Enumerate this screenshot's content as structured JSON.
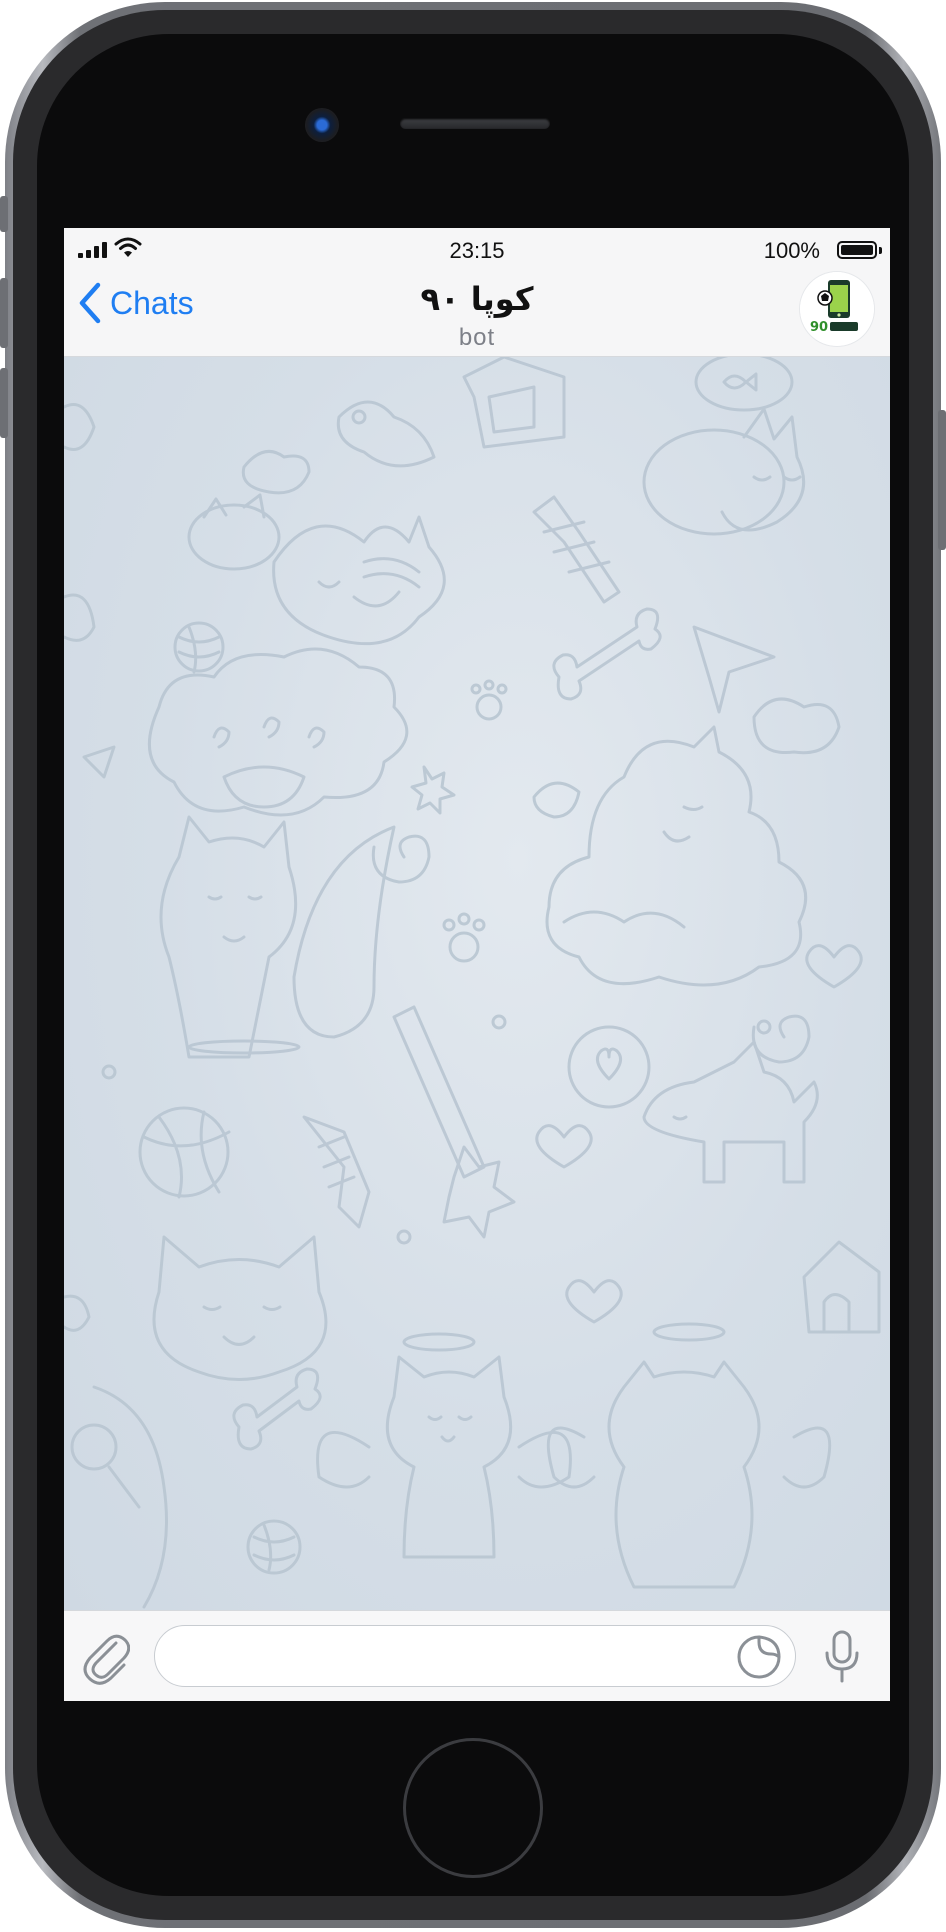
{
  "status_bar": {
    "time": "23:15",
    "battery_percent": "100%",
    "battery_level": 1.0,
    "icons": [
      "signal-icon",
      "wifi-icon",
      "battery-icon"
    ]
  },
  "nav_bar": {
    "back_label": "Chats",
    "title": "کوپا ۹۰",
    "subtitle": "bot",
    "back_icon": "chevron-left-icon",
    "avatar_icon": "bot-avatar-icon",
    "accent_color": "#1f7ef2"
  },
  "chat": {
    "background_color": "#d3dde6",
    "pattern_icon": "doodle-pattern"
  },
  "input_bar": {
    "placeholder": "",
    "attach_icon": "paperclip-icon",
    "sticker_icon": "sticker-icon",
    "mic_icon": "microphone-icon"
  }
}
